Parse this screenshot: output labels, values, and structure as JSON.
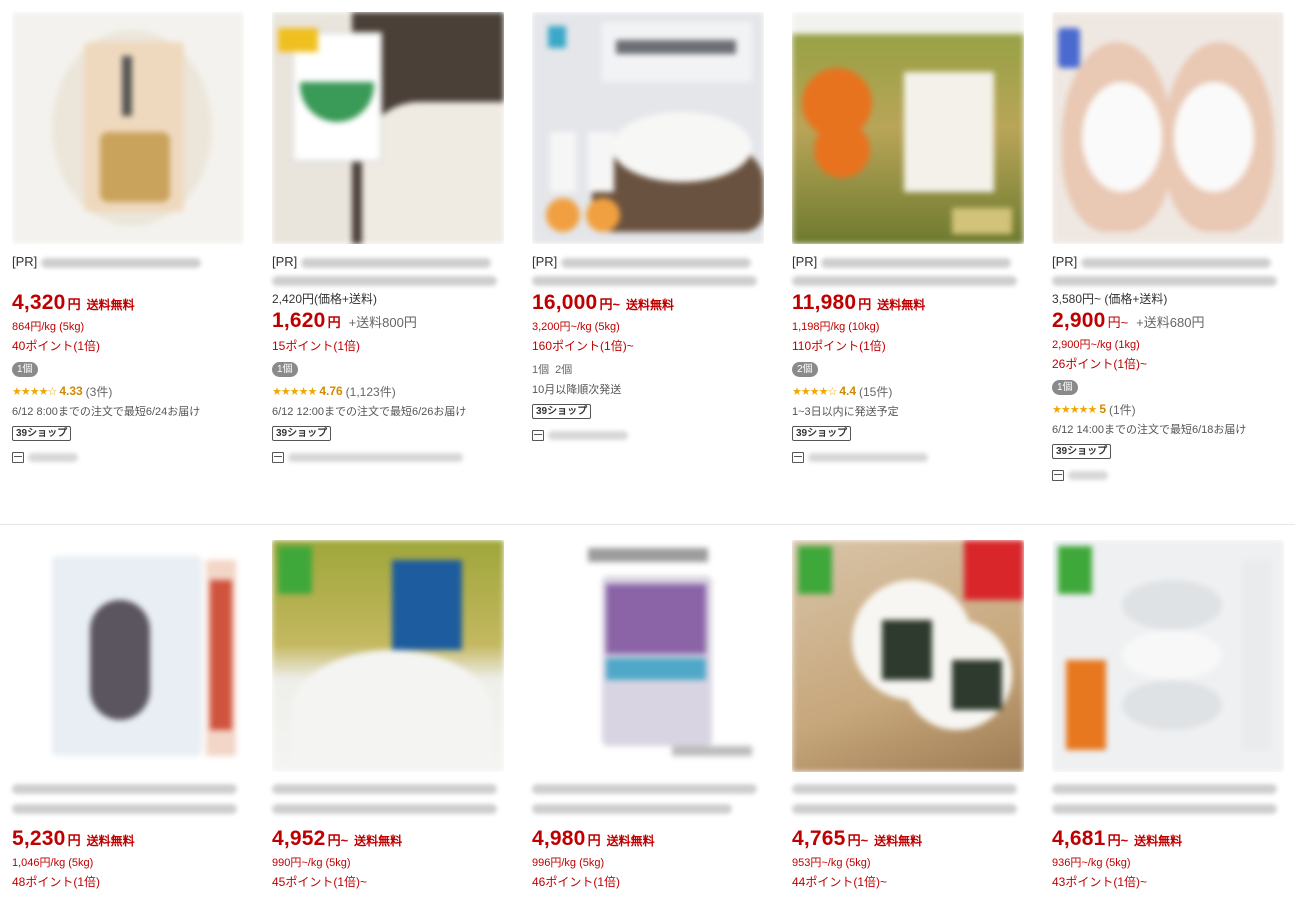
{
  "colors": {
    "price": "#bf0000",
    "rating": "#f0a800",
    "badge_bg": "#8a8a8a"
  },
  "row1": [
    {
      "pr": "[PR]",
      "price_original": "",
      "price": "4,320",
      "yen": "円",
      "shipping": "送料無料",
      "unit_price": "864円/kg (5kg)",
      "points": "40ポイント(1倍)",
      "qty": [
        "1個"
      ],
      "stars": "★★★★☆",
      "rating": "4.33",
      "reviews": "(3件)",
      "delivery": "6/12 8:00までの注文で最短6/24お届け",
      "shop_badge": "39ショップ"
    },
    {
      "pr": "[PR]",
      "price_original": "2,420円(価格+送料)",
      "price": "1,620",
      "yen": "円",
      "shipping": "+送料800円",
      "unit_price": "",
      "points": "15ポイント(1倍)",
      "qty": [
        "1個"
      ],
      "stars": "★★★★★",
      "rating": "4.76",
      "reviews": "(1,123件)",
      "delivery": "6/12 12:00までの注文で最短6/26お届け",
      "shop_badge": "39ショップ"
    },
    {
      "pr": "[PR]",
      "price_original": "",
      "price": "16,000",
      "yen": "円~",
      "shipping": "送料無料",
      "unit_price": "3,200円~/kg (5kg)",
      "points": "160ポイント(1倍)~",
      "qty": [
        "1個",
        "2個"
      ],
      "stars": "",
      "rating": "",
      "reviews": "",
      "delivery": "10月以降順次発送",
      "shop_badge": "39ショップ"
    },
    {
      "pr": "[PR]",
      "price_original": "",
      "price": "11,980",
      "yen": "円",
      "shipping": "送料無料",
      "unit_price": "1,198円/kg (10kg)",
      "points": "110ポイント(1倍)",
      "qty": [
        "2個"
      ],
      "stars": "★★★★☆",
      "rating": "4.4",
      "reviews": "(15件)",
      "delivery": "1~3日以内に発送予定",
      "shop_badge": "39ショップ"
    },
    {
      "pr": "[PR]",
      "price_original": "3,580円~ (価格+送料)",
      "price": "2,900",
      "yen": "円~",
      "shipping": "+送料680円",
      "unit_price": "2,900円~/kg (1kg)",
      "points": "26ポイント(1倍)~",
      "qty": [
        "1個"
      ],
      "stars": "★★★★★",
      "rating": "5",
      "reviews": "(1件)",
      "delivery": "6/12 14:00までの注文で最短6/18お届け",
      "shop_badge": "39ショップ"
    }
  ],
  "row2": [
    {
      "price": "5,230",
      "yen": "円",
      "shipping": "送料無料",
      "unit_price": "1,046円/kg (5kg)",
      "points": "48ポイント(1倍)"
    },
    {
      "price": "4,952",
      "yen": "円~",
      "shipping": "送料無料",
      "unit_price": "990円~/kg (5kg)",
      "points": "45ポイント(1倍)~"
    },
    {
      "price": "4,980",
      "yen": "円",
      "shipping": "送料無料",
      "unit_price": "996円/kg (5kg)",
      "points": "46ポイント(1倍)"
    },
    {
      "price": "4,765",
      "yen": "円~",
      "shipping": "送料無料",
      "unit_price": "953円~/kg (5kg)",
      "points": "44ポイント(1倍)~"
    },
    {
      "price": "4,681",
      "yen": "円~",
      "shipping": "送料無料",
      "unit_price": "936円~/kg (5kg)",
      "points": "43ポイント(1倍)~"
    }
  ]
}
